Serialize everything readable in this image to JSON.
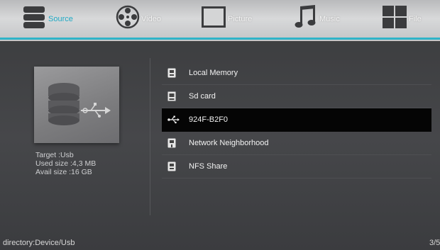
{
  "tabs": [
    {
      "id": "source",
      "label": "Source",
      "icon": "database-icon",
      "active": true
    },
    {
      "id": "video",
      "label": "Video",
      "icon": "film-reel-icon",
      "active": false
    },
    {
      "id": "picture",
      "label": "Picture",
      "icon": "picture-frame-icon",
      "active": false
    },
    {
      "id": "music",
      "label": "Music",
      "icon": "music-note-icon",
      "active": false
    },
    {
      "id": "file",
      "label": "File",
      "icon": "grid-icon",
      "active": false
    }
  ],
  "colors": {
    "accent": "#2fb4c8",
    "selected_row": "#050505"
  },
  "device": {
    "icon": "usb-storage-icon",
    "target": "Target :Usb",
    "used": "Used size :4,3 MB",
    "avail": "Avail size :16 GB"
  },
  "sources": [
    {
      "label": "Local Memory",
      "icon": "local-memory-icon",
      "selected": false
    },
    {
      "label": "Sd card",
      "icon": "sd-card-icon",
      "selected": false
    },
    {
      "label": "924F-B2F0",
      "icon": "usb-icon",
      "selected": true
    },
    {
      "label": "Network Neighborhood",
      "icon": "network-icon",
      "selected": false
    },
    {
      "label": "NFS Share",
      "icon": "nfs-share-icon",
      "selected": false
    }
  ],
  "status": {
    "directory": "directory:Device/Usb",
    "page": "3/5"
  }
}
